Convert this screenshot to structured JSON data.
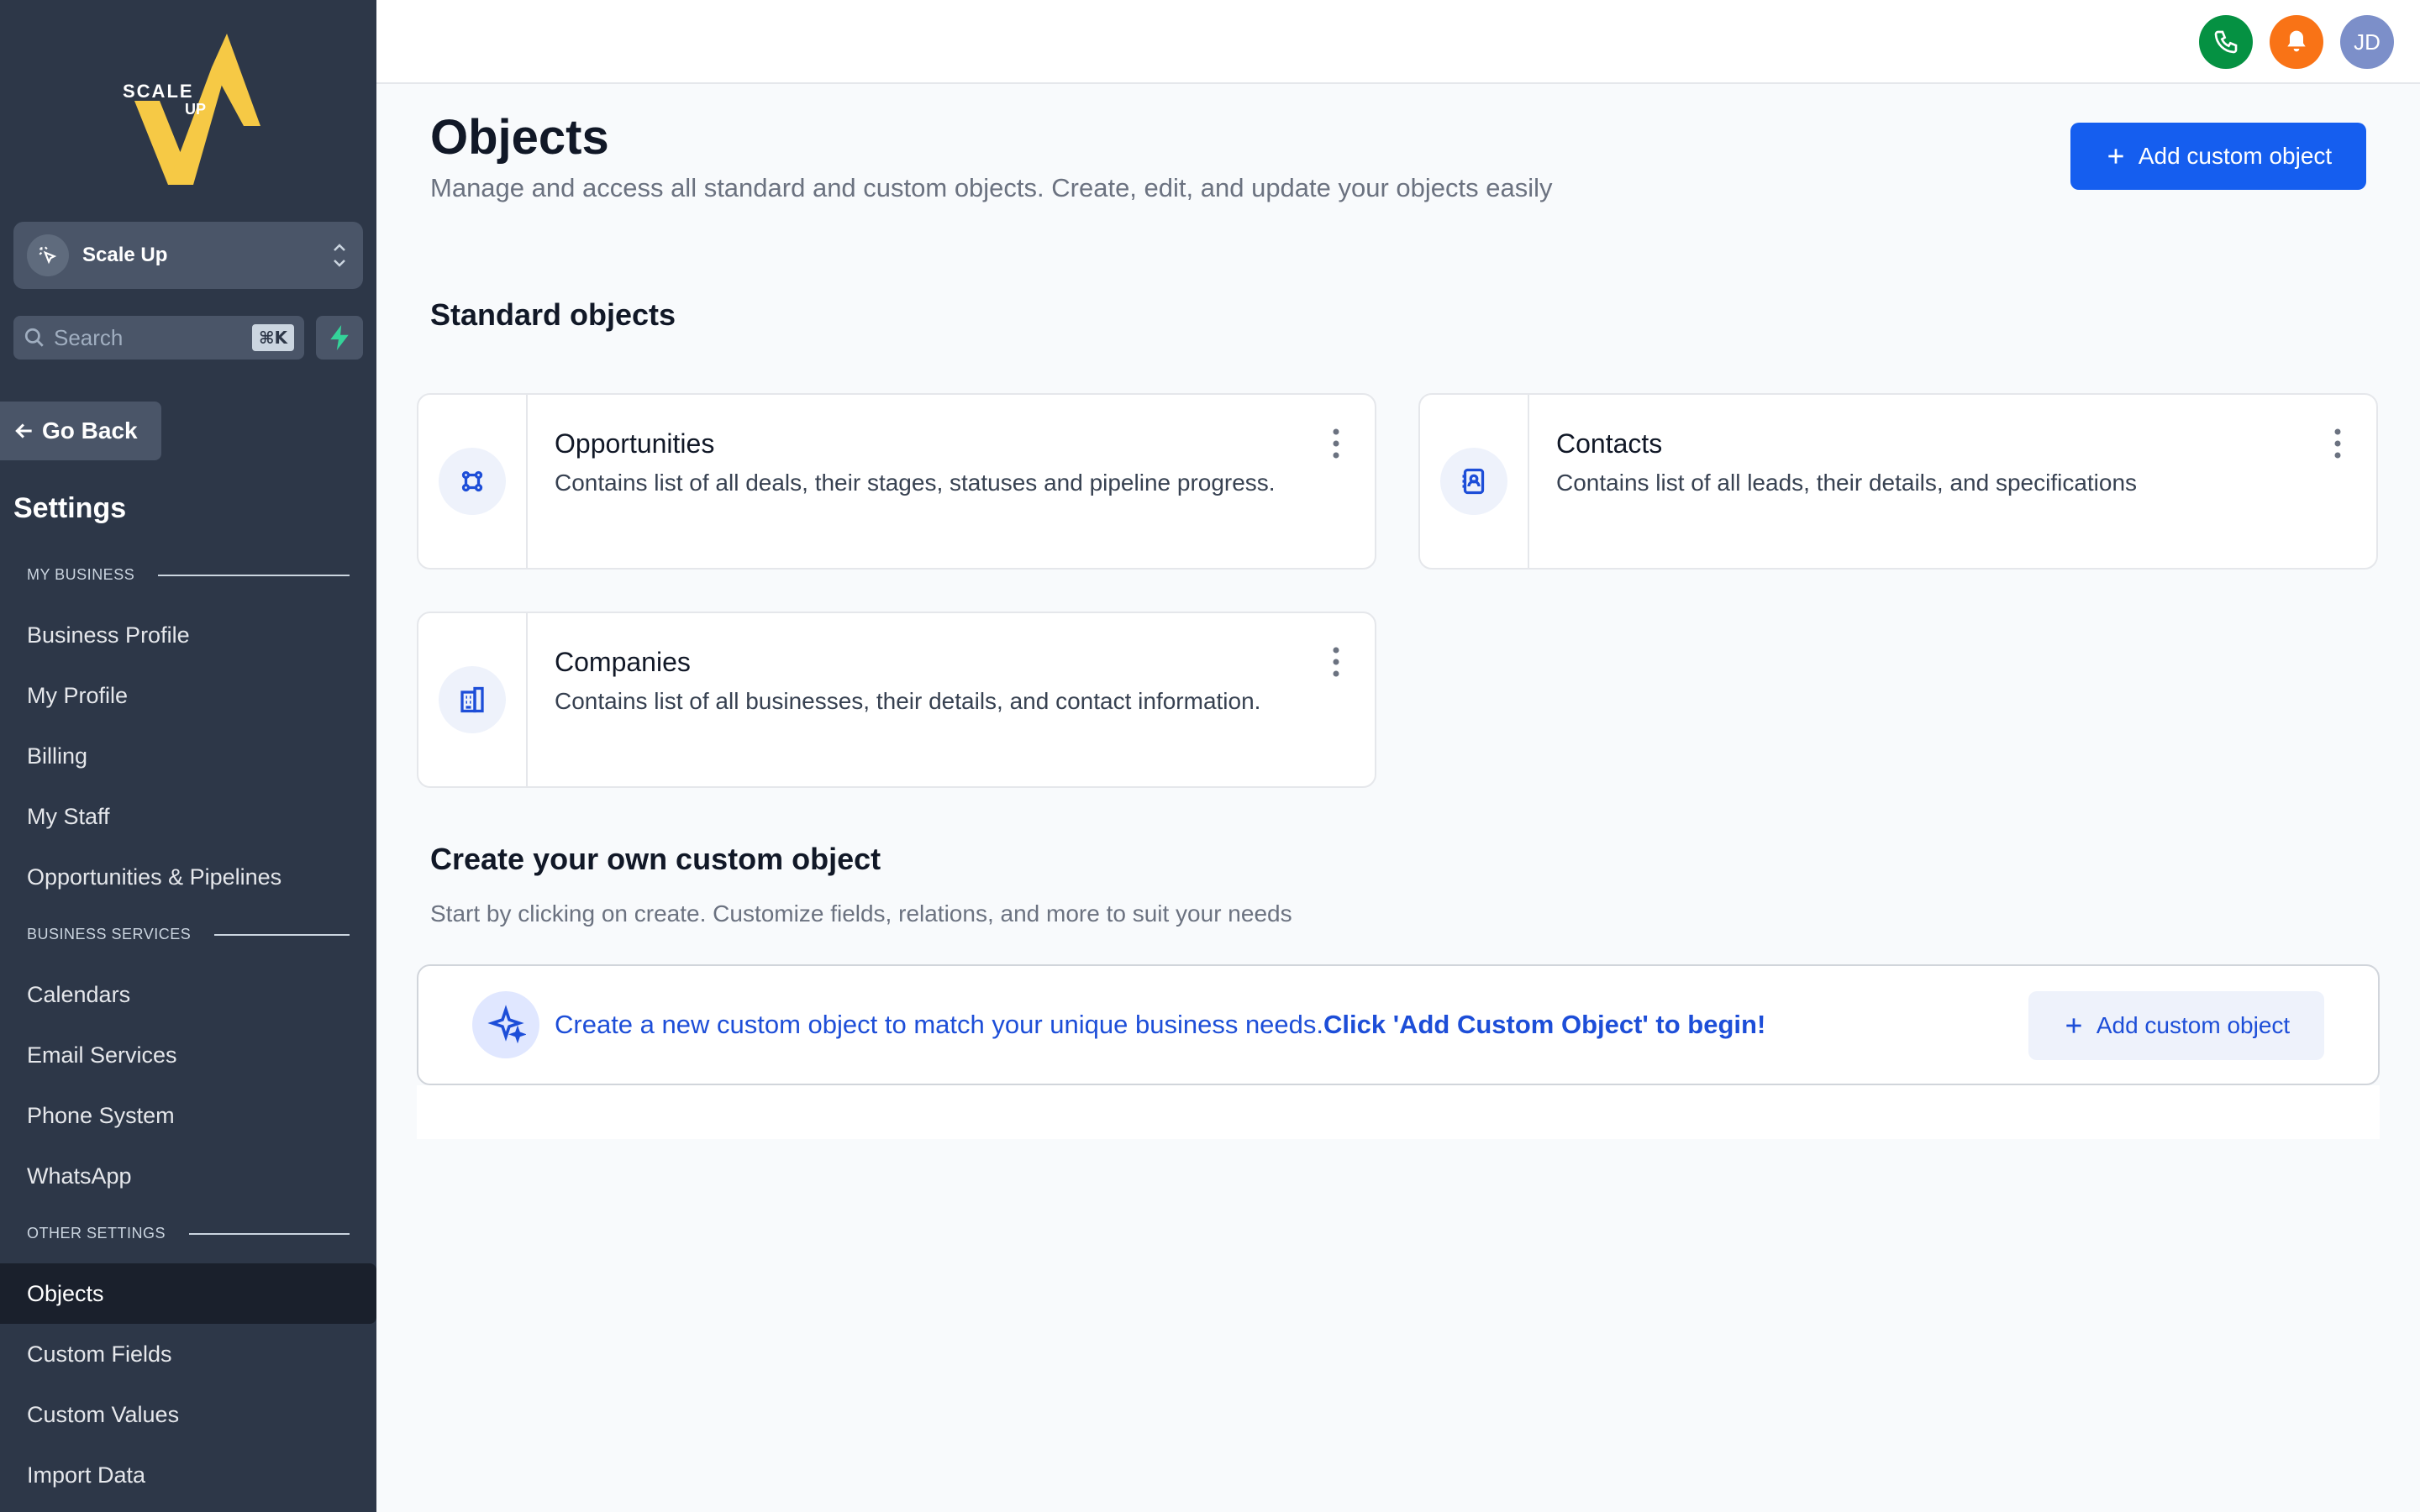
{
  "app": {
    "logo_text_top": "SCALE",
    "logo_text_side": "UP"
  },
  "sidebar": {
    "workspace": "Scale Up",
    "search_placeholder": "Search",
    "search_shortcut": "⌘K",
    "go_back": "Go Back",
    "title": "Settings",
    "sections": [
      {
        "label": "MY BUSINESS",
        "items": [
          "Business Profile",
          "My Profile",
          "Billing",
          "My Staff",
          "Opportunities & Pipelines"
        ]
      },
      {
        "label": "BUSINESS SERVICES",
        "items": [
          "Calendars",
          "Email Services",
          "Phone System",
          "WhatsApp"
        ]
      },
      {
        "label": "OTHER SETTINGS",
        "items": [
          "Objects",
          "Custom Fields",
          "Custom Values",
          "Import Data"
        ]
      }
    ],
    "active_item": "Objects"
  },
  "topbar": {
    "avatar_initials": "JD",
    "phone_color": "#059142",
    "bell_color": "#f97316"
  },
  "main": {
    "title": "Objects",
    "subtitle": "Manage and access all standard and custom objects. Create, edit, and update your objects easily",
    "add_button": "Add custom object",
    "standard_heading": "Standard objects",
    "cards": [
      {
        "title": "Opportunities",
        "desc": "Contains list of all deals, their stages, statuses and pipeline progress.",
        "icon": "opportunities-icon"
      },
      {
        "title": "Contacts",
        "desc": "Contains list of all leads, their details, and specifications",
        "icon": "contacts-icon"
      },
      {
        "title": "Companies",
        "desc": "Contains list of all businesses, their details, and contact information.",
        "icon": "companies-icon"
      }
    ],
    "custom_heading": "Create your own custom object",
    "custom_sub": "Start by clicking on create. Customize fields, relations, and more to suit your needs",
    "banner_text": "Create a new custom object to match your unique business needs.",
    "banner_bold": "Click 'Add Custom Object' to begin!",
    "banner_button": "Add custom object"
  },
  "colors": {
    "primary": "#155eef",
    "sidebar_bg": "#2d3748",
    "accent_text": "#1d4ed8"
  }
}
